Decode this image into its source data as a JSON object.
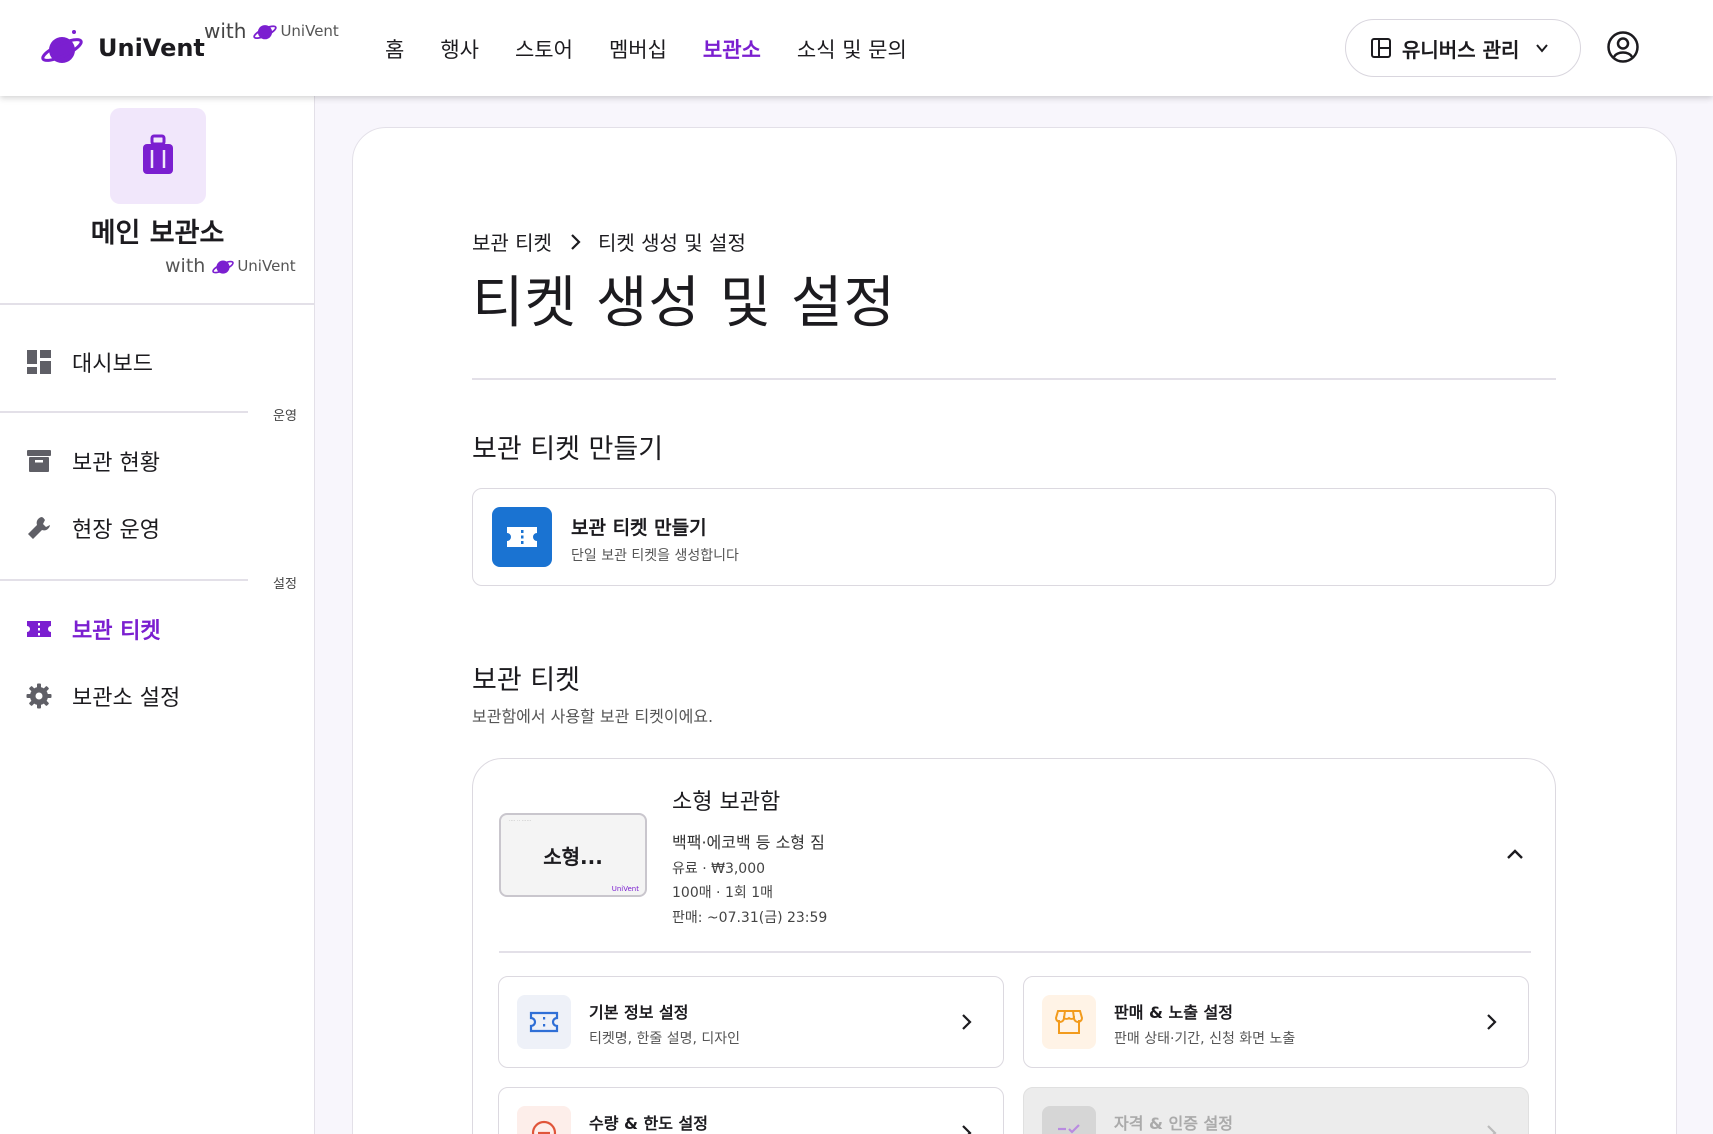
{
  "header": {
    "brand_name": "UniVent",
    "with_label": "with",
    "partner_name": "UniVent",
    "nav": [
      "홈",
      "행사",
      "스토어",
      "멤버십",
      "보관소",
      "소식 및 문의"
    ],
    "active_nav": "보관소",
    "manage_label": "유니버스 관리"
  },
  "sidebar": {
    "store_title": "메인 보관소",
    "with_label": "with",
    "partner_name": "UniVent",
    "dashboard": "대시보드",
    "section_ops": "운영",
    "status": "보관 현황",
    "onsite": "현장 운영",
    "section_settings": "설정",
    "tickets": "보관 티켓",
    "store_settings": "보관소 설정"
  },
  "main": {
    "breadcrumb": [
      "보관 티켓",
      "티켓 생성 및 설정"
    ],
    "page_title": "티켓 생성 및 설정",
    "create_section_title": "보관 티켓 만들기",
    "create_card": {
      "title": "보관 티켓 만들기",
      "subtitle": "단일 보관 티켓을 생성합니다"
    },
    "list_section_title": "보관 티켓",
    "list_section_sub": "보관함에서 사용할 보관 티켓이에요.",
    "ticket": {
      "thumb_label": "소형...",
      "thumb_watermark": "UniVent",
      "name": "소형 보관함",
      "desc": "백팩·에코백 등 소형 짐",
      "price": "유료 · ₩3,000",
      "quantity": "100매 · 1회 1매",
      "sale": "판매: ~07.31(금) 23:59"
    },
    "settings": [
      {
        "title": "기본 정보 설정",
        "sub": "티켓명, 한줄 설명, 디자인"
      },
      {
        "title": "판매 & 노출 설정",
        "sub": "판매 상태·기간, 신청 화면 노출"
      },
      {
        "title": "수량 & 한도 설정",
        "sub": ""
      },
      {
        "title": "자격 & 인증 설정",
        "sub": ""
      }
    ]
  },
  "colors": {
    "accent": "#7b1fd0",
    "create_icon_bg": "#1a73d2",
    "store_icon_bg": "#f1e7fb"
  }
}
